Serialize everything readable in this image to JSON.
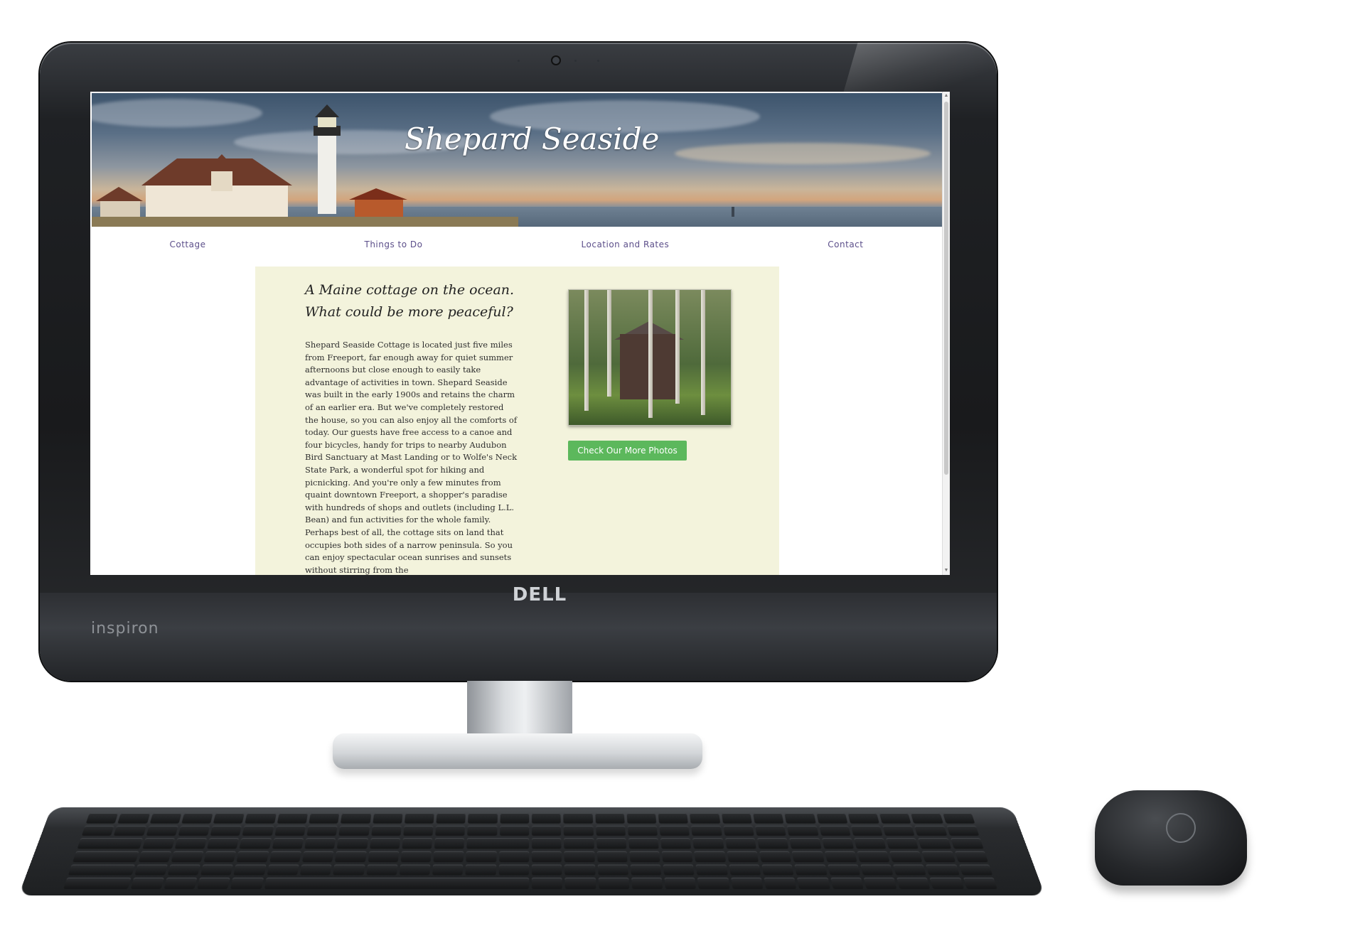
{
  "device": {
    "brand": "DELL",
    "model": "inspiron"
  },
  "website": {
    "title": "Shepard Seaside",
    "nav": [
      {
        "label": "Cottage"
      },
      {
        "label": "Things to Do"
      },
      {
        "label": "Location and Rates"
      },
      {
        "label": "Contact"
      }
    ],
    "tagline_line1": "A Maine cottage on the ocean.",
    "tagline_line2": "What could be more peaceful?",
    "body": "Shepard Seaside Cottage is located just five miles from Freeport, far enough away for quiet summer afternoons but close enough to easily take advantage of activities in town. Shepard Seaside was built in the early 1900s and retains the charm of an earlier era. But we've completely restored the house, so you can also enjoy all the comforts of today. Our guests have free access to a canoe and four bicycles, handy for trips to nearby Audubon Bird Sanctuary at Mast Landing or to Wolfe's Neck State Park, a wonderful spot for hiking and picnicking. And you're only a few minutes from quaint downtown Freeport, a shopper's paradise with hundreds of shops and outlets (including L.L. Bean) and fun activities for the whole family. Perhaps best of all, the cottage sits on land that occupies both sides of a narrow peninsula. So you can enjoy spectacular ocean sunrises and sunsets without stirring from the",
    "cta_label": "Check Our More Photos"
  },
  "colors": {
    "content_bg": "#f3f3dc",
    "cta_green": "#5cb85c",
    "nav_text": "#5c4f8a"
  }
}
